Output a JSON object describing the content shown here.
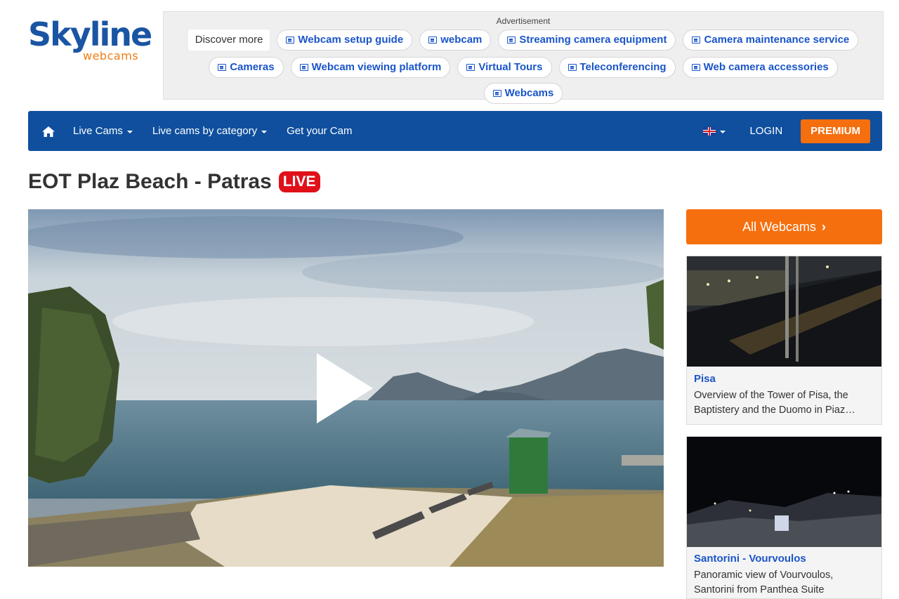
{
  "logo": {
    "main": "Skyline",
    "sub": "webcams"
  },
  "ad": {
    "label": "Advertisement",
    "discover": "Discover more",
    "row1": [
      "Webcam setup guide",
      "webcam",
      "Streaming camera equipment",
      "Camera maintenance service"
    ],
    "row2": [
      "Cameras",
      "Webcam viewing platform",
      "Virtual Tours",
      "Teleconferencing",
      "Web camera accessories"
    ],
    "row3": [
      "Webcams"
    ]
  },
  "nav": {
    "items": [
      "Live Cams",
      "Live cams by category",
      "Get your Cam"
    ],
    "login": "LOGIN",
    "premium": "PREMIUM"
  },
  "page": {
    "title": "EOT Plaz Beach - Patras",
    "live": "LIVE"
  },
  "sidebar": {
    "all_webcams": "All Webcams",
    "cards": [
      {
        "title": "Pisa",
        "desc_line1": "Overview of the Tower of Pisa, the",
        "desc_line2": "Baptistery and the Duomo in Piaz…"
      },
      {
        "title": "Santorini - Vourvoulos",
        "desc_line1": "Panoramic view of Vourvoulos,",
        "desc_line2": "Santorini from Panthea Suite"
      }
    ]
  },
  "colors": {
    "brand_blue": "#0f4f9e",
    "accent_orange": "#f56f0f",
    "live_red": "#e0101a",
    "link_blue": "#1a55c8"
  }
}
